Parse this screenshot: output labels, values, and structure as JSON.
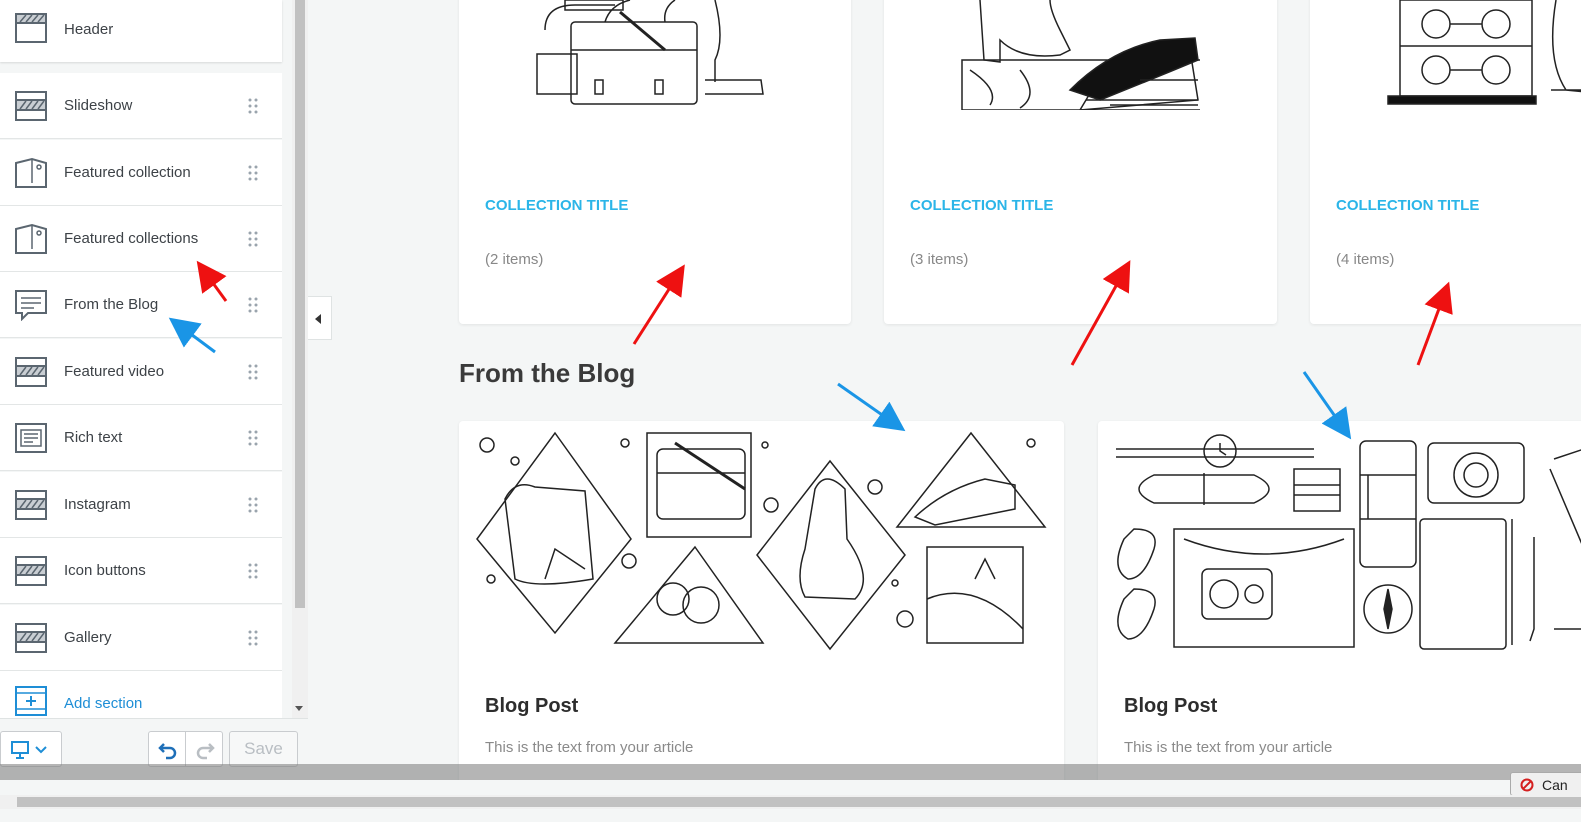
{
  "sidebar": {
    "sections": [
      {
        "label": "Header",
        "icon": "header-section-icon"
      },
      {
        "label": "Slideshow",
        "icon": "slideshow-section-icon"
      },
      {
        "label": "Featured collection",
        "icon": "collection-tag-icon"
      },
      {
        "label": "Featured collections",
        "icon": "collection-tag-icon"
      },
      {
        "label": "From the Blog",
        "icon": "blog-comment-icon"
      },
      {
        "label": "Featured video",
        "icon": "video-section-icon"
      },
      {
        "label": "Rich text",
        "icon": "rich-text-icon"
      },
      {
        "label": "Instagram",
        "icon": "instagram-section-icon"
      },
      {
        "label": "Icon buttons",
        "icon": "icon-buttons-section-icon"
      },
      {
        "label": "Gallery",
        "icon": "gallery-section-icon"
      }
    ],
    "add_section": "Add section",
    "save_label": "Save"
  },
  "preview": {
    "collections": [
      {
        "title": "COLLECTION TITLE",
        "count": "(2 items)"
      },
      {
        "title": "COLLECTION TITLE",
        "count": "(3 items)"
      },
      {
        "title": "COLLECTION TITLE",
        "count": "(4 items)"
      }
    ],
    "blog_heading": "From the Blog",
    "posts": [
      {
        "title": "Blog Post",
        "text": "This is the text from your article"
      },
      {
        "title": "Blog Post",
        "text": "This is the text from your article"
      }
    ]
  },
  "cancel_label": "Can",
  "colors": {
    "accent": "#2bb5e8",
    "link": "#1e8ed6",
    "annotation_red": "#ee1111",
    "annotation_blue": "#1a95e6"
  }
}
